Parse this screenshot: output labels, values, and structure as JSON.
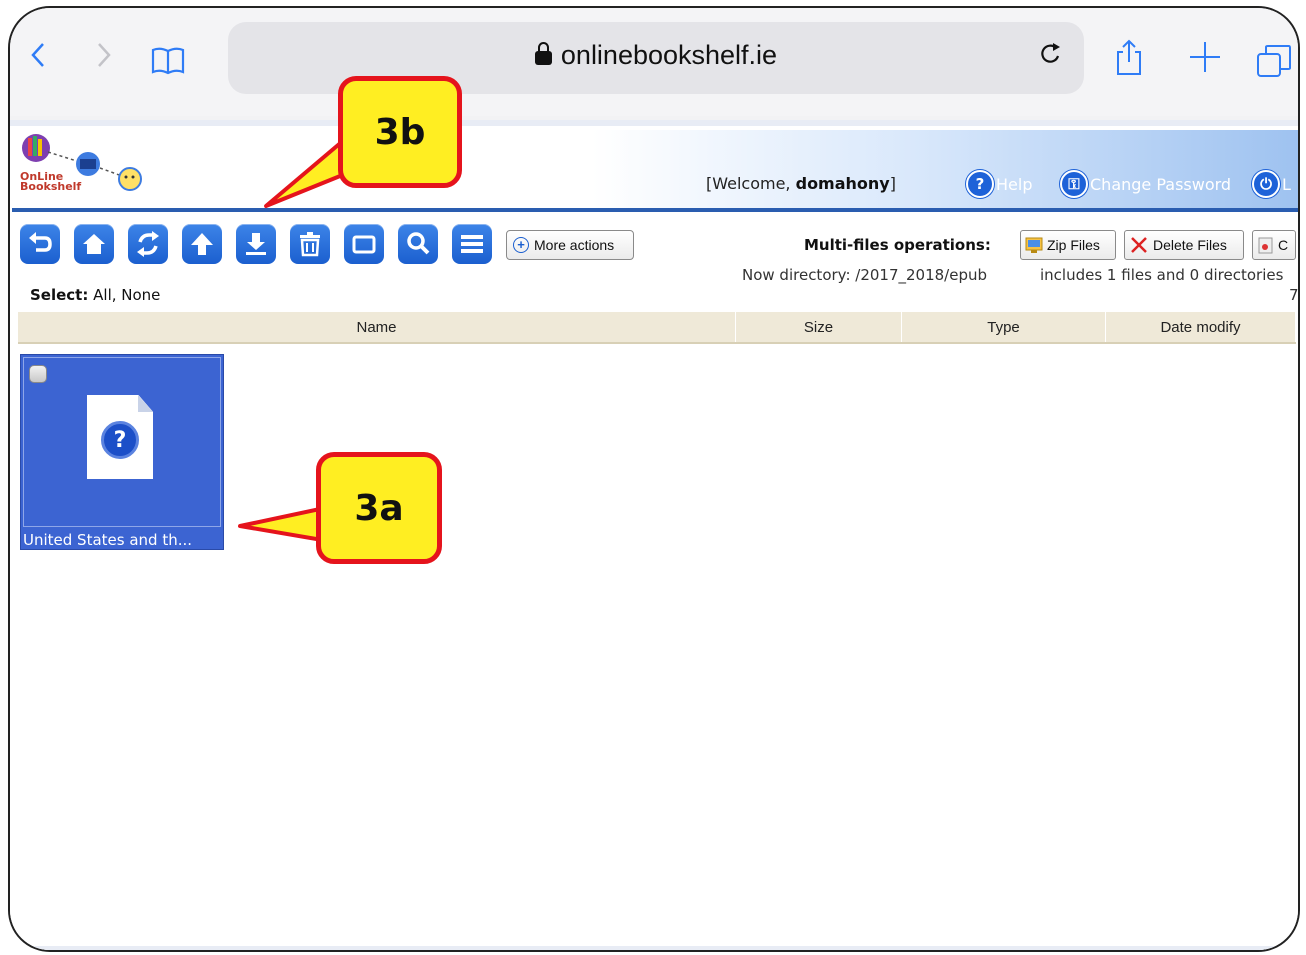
{
  "browser": {
    "url": "onlinebookshelf.ie",
    "back_glyph": "‹",
    "forward_glyph": "›",
    "reload_glyph": "↻",
    "share_glyph": "⇪",
    "new_tab_glyph": "+"
  },
  "header": {
    "logo_line1": "OnLine",
    "logo_line2": "Bookshelf",
    "welcome_prefix": "[Welcome, ",
    "username": "domahony",
    "welcome_suffix": "]",
    "help_label": "Help",
    "change_password_label": "Change Password",
    "logout_label": "L"
  },
  "toolbar": {
    "more_actions_label": "More actions",
    "multi_label": "Multi-files operations:",
    "zip_label": "Zip Files",
    "delete_label": "Delete Files",
    "cut_label": "C"
  },
  "selection": {
    "select_label": "Select:",
    "select_options": "All, None"
  },
  "directory": {
    "now_directory": "Now directory: /2017_2018/epub",
    "includes": "includes 1 files and 0 directories",
    "extra": "7"
  },
  "columns": [
    "Name",
    "Size",
    "Type",
    "Date modify"
  ],
  "files": [
    {
      "name": "United States and th..."
    }
  ],
  "annotations": {
    "callout_a": "3a",
    "callout_b": "3b"
  },
  "colors": {
    "accent": "#1b5fcf",
    "tile_bg": "#3c64d2",
    "callout_fill": "#ffee22",
    "callout_border": "#e5141c"
  }
}
